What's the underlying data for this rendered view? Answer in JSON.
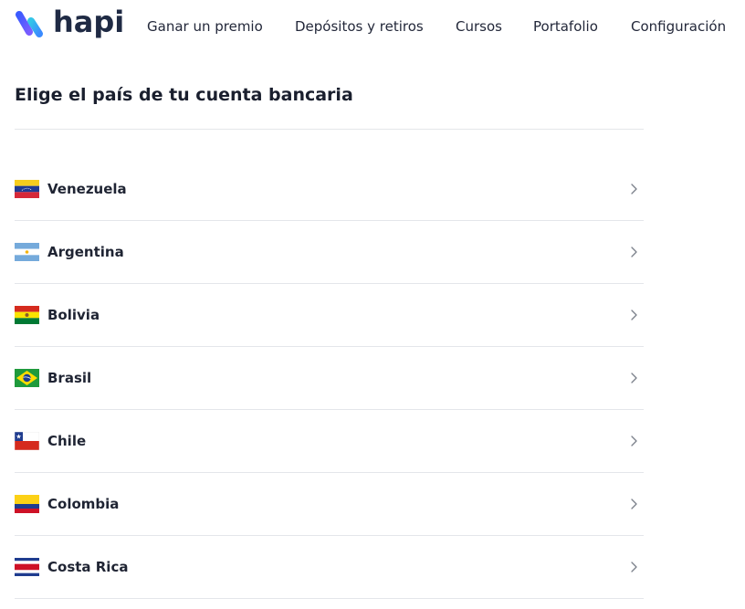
{
  "brand": {
    "name": "hapi",
    "accent_colors": [
      "#3b5bff",
      "#7b5cff",
      "#33c6e8"
    ]
  },
  "nav": {
    "items": [
      {
        "label": "Ganar un premio"
      },
      {
        "label": "Depósitos y retiros"
      },
      {
        "label": "Cursos"
      },
      {
        "label": "Portafolio"
      },
      {
        "label": "Configuración"
      }
    ]
  },
  "main": {
    "title": "Elige el país de tu cuenta bancaria",
    "countries": [
      {
        "name": "Venezuela",
        "flag": "venezuela-flag-icon"
      },
      {
        "name": "Argentina",
        "flag": "argentina-flag-icon"
      },
      {
        "name": "Bolivia",
        "flag": "bolivia-flag-icon"
      },
      {
        "name": "Brasil",
        "flag": "brazil-flag-icon"
      },
      {
        "name": "Chile",
        "flag": "chile-flag-icon"
      },
      {
        "name": "Colombia",
        "flag": "colombia-flag-icon"
      },
      {
        "name": "Costa Rica",
        "flag": "costa-rica-flag-icon"
      }
    ],
    "row_icon": "chevron-right-icon"
  }
}
